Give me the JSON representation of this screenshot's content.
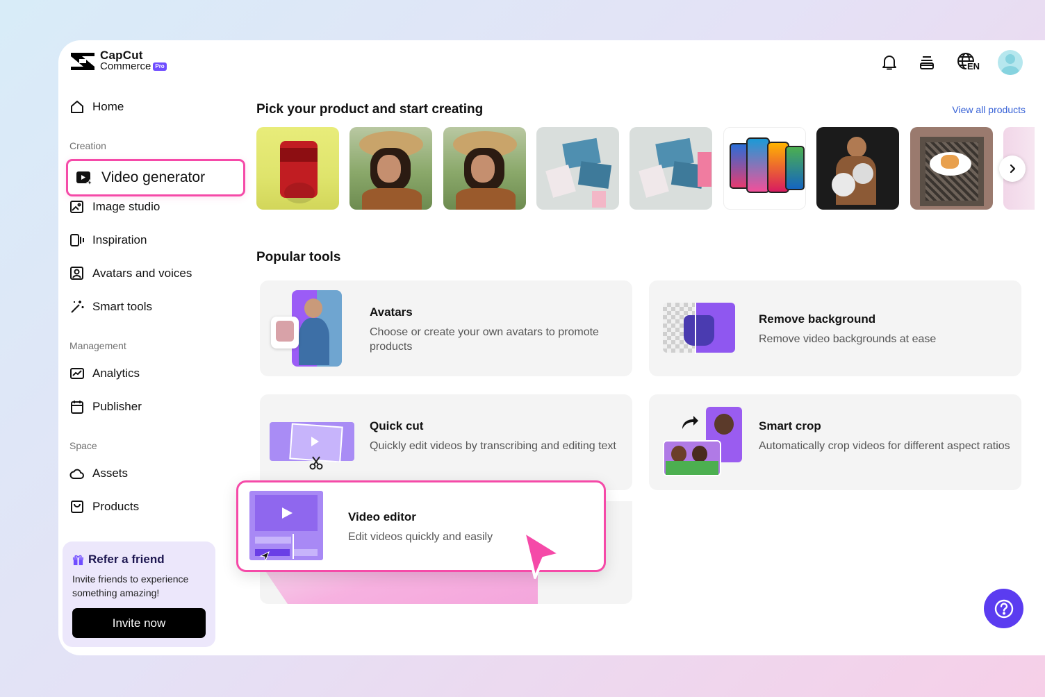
{
  "logo": {
    "line1": "CapCut",
    "line2": "Commerce",
    "badge": "Pro"
  },
  "header": {
    "language": "EN"
  },
  "sidebar": {
    "home": "Home",
    "creation_label": "Creation",
    "video_generator": "Video generator",
    "image_studio": "Image studio",
    "inspiration": "Inspiration",
    "avatars_voices": "Avatars and voices",
    "smart_tools": "Smart tools",
    "management_label": "Management",
    "analytics": "Analytics",
    "publisher": "Publisher",
    "space_label": "Space",
    "assets": "Assets",
    "products": "Products"
  },
  "refer": {
    "title": "Refer a friend",
    "description": "Invite friends to experience something amazing!",
    "button": "Invite now"
  },
  "main": {
    "products_title": "Pick your product and start creating",
    "view_all": "View all products",
    "tools_title": "Popular tools",
    "tools": [
      {
        "title": "Avatars",
        "desc": "Choose or create your own avatars to promote products"
      },
      {
        "title": "Remove background",
        "desc": "Remove video backgrounds at ease"
      },
      {
        "title": "Quick cut",
        "desc": "Quickly edit videos by transcribing and editing text"
      },
      {
        "title": "Smart crop",
        "desc": "Automatically crop videos for different aspect ratios"
      }
    ],
    "highlight": {
      "title": "Video editor",
      "desc": "Edit videos quickly and easily"
    }
  },
  "colors": {
    "accent": "#f54aa8",
    "brand_purple": "#6f4dff",
    "help": "#5b3cf0",
    "link": "#3560d6"
  }
}
